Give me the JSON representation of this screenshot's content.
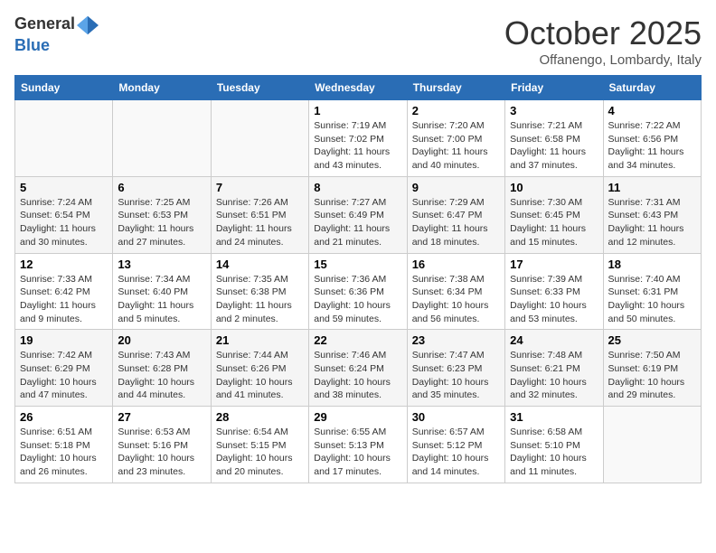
{
  "logo": {
    "general": "General",
    "blue": "Blue"
  },
  "header": {
    "month": "October 2025",
    "location": "Offanengo, Lombardy, Italy"
  },
  "weekdays": [
    "Sunday",
    "Monday",
    "Tuesday",
    "Wednesday",
    "Thursday",
    "Friday",
    "Saturday"
  ],
  "weeks": [
    [
      {
        "day": "",
        "sunrise": "",
        "sunset": "",
        "daylight": ""
      },
      {
        "day": "",
        "sunrise": "",
        "sunset": "",
        "daylight": ""
      },
      {
        "day": "",
        "sunrise": "",
        "sunset": "",
        "daylight": ""
      },
      {
        "day": "1",
        "sunrise": "Sunrise: 7:19 AM",
        "sunset": "Sunset: 7:02 PM",
        "daylight": "Daylight: 11 hours and 43 minutes."
      },
      {
        "day": "2",
        "sunrise": "Sunrise: 7:20 AM",
        "sunset": "Sunset: 7:00 PM",
        "daylight": "Daylight: 11 hours and 40 minutes."
      },
      {
        "day": "3",
        "sunrise": "Sunrise: 7:21 AM",
        "sunset": "Sunset: 6:58 PM",
        "daylight": "Daylight: 11 hours and 37 minutes."
      },
      {
        "day": "4",
        "sunrise": "Sunrise: 7:22 AM",
        "sunset": "Sunset: 6:56 PM",
        "daylight": "Daylight: 11 hours and 34 minutes."
      }
    ],
    [
      {
        "day": "5",
        "sunrise": "Sunrise: 7:24 AM",
        "sunset": "Sunset: 6:54 PM",
        "daylight": "Daylight: 11 hours and 30 minutes."
      },
      {
        "day": "6",
        "sunrise": "Sunrise: 7:25 AM",
        "sunset": "Sunset: 6:53 PM",
        "daylight": "Daylight: 11 hours and 27 minutes."
      },
      {
        "day": "7",
        "sunrise": "Sunrise: 7:26 AM",
        "sunset": "Sunset: 6:51 PM",
        "daylight": "Daylight: 11 hours and 24 minutes."
      },
      {
        "day": "8",
        "sunrise": "Sunrise: 7:27 AM",
        "sunset": "Sunset: 6:49 PM",
        "daylight": "Daylight: 11 hours and 21 minutes."
      },
      {
        "day": "9",
        "sunrise": "Sunrise: 7:29 AM",
        "sunset": "Sunset: 6:47 PM",
        "daylight": "Daylight: 11 hours and 18 minutes."
      },
      {
        "day": "10",
        "sunrise": "Sunrise: 7:30 AM",
        "sunset": "Sunset: 6:45 PM",
        "daylight": "Daylight: 11 hours and 15 minutes."
      },
      {
        "day": "11",
        "sunrise": "Sunrise: 7:31 AM",
        "sunset": "Sunset: 6:43 PM",
        "daylight": "Daylight: 11 hours and 12 minutes."
      }
    ],
    [
      {
        "day": "12",
        "sunrise": "Sunrise: 7:33 AM",
        "sunset": "Sunset: 6:42 PM",
        "daylight": "Daylight: 11 hours and 9 minutes."
      },
      {
        "day": "13",
        "sunrise": "Sunrise: 7:34 AM",
        "sunset": "Sunset: 6:40 PM",
        "daylight": "Daylight: 11 hours and 5 minutes."
      },
      {
        "day": "14",
        "sunrise": "Sunrise: 7:35 AM",
        "sunset": "Sunset: 6:38 PM",
        "daylight": "Daylight: 11 hours and 2 minutes."
      },
      {
        "day": "15",
        "sunrise": "Sunrise: 7:36 AM",
        "sunset": "Sunset: 6:36 PM",
        "daylight": "Daylight: 10 hours and 59 minutes."
      },
      {
        "day": "16",
        "sunrise": "Sunrise: 7:38 AM",
        "sunset": "Sunset: 6:34 PM",
        "daylight": "Daylight: 10 hours and 56 minutes."
      },
      {
        "day": "17",
        "sunrise": "Sunrise: 7:39 AM",
        "sunset": "Sunset: 6:33 PM",
        "daylight": "Daylight: 10 hours and 53 minutes."
      },
      {
        "day": "18",
        "sunrise": "Sunrise: 7:40 AM",
        "sunset": "Sunset: 6:31 PM",
        "daylight": "Daylight: 10 hours and 50 minutes."
      }
    ],
    [
      {
        "day": "19",
        "sunrise": "Sunrise: 7:42 AM",
        "sunset": "Sunset: 6:29 PM",
        "daylight": "Daylight: 10 hours and 47 minutes."
      },
      {
        "day": "20",
        "sunrise": "Sunrise: 7:43 AM",
        "sunset": "Sunset: 6:28 PM",
        "daylight": "Daylight: 10 hours and 44 minutes."
      },
      {
        "day": "21",
        "sunrise": "Sunrise: 7:44 AM",
        "sunset": "Sunset: 6:26 PM",
        "daylight": "Daylight: 10 hours and 41 minutes."
      },
      {
        "day": "22",
        "sunrise": "Sunrise: 7:46 AM",
        "sunset": "Sunset: 6:24 PM",
        "daylight": "Daylight: 10 hours and 38 minutes."
      },
      {
        "day": "23",
        "sunrise": "Sunrise: 7:47 AM",
        "sunset": "Sunset: 6:23 PM",
        "daylight": "Daylight: 10 hours and 35 minutes."
      },
      {
        "day": "24",
        "sunrise": "Sunrise: 7:48 AM",
        "sunset": "Sunset: 6:21 PM",
        "daylight": "Daylight: 10 hours and 32 minutes."
      },
      {
        "day": "25",
        "sunrise": "Sunrise: 7:50 AM",
        "sunset": "Sunset: 6:19 PM",
        "daylight": "Daylight: 10 hours and 29 minutes."
      }
    ],
    [
      {
        "day": "26",
        "sunrise": "Sunrise: 6:51 AM",
        "sunset": "Sunset: 5:18 PM",
        "daylight": "Daylight: 10 hours and 26 minutes."
      },
      {
        "day": "27",
        "sunrise": "Sunrise: 6:53 AM",
        "sunset": "Sunset: 5:16 PM",
        "daylight": "Daylight: 10 hours and 23 minutes."
      },
      {
        "day": "28",
        "sunrise": "Sunrise: 6:54 AM",
        "sunset": "Sunset: 5:15 PM",
        "daylight": "Daylight: 10 hours and 20 minutes."
      },
      {
        "day": "29",
        "sunrise": "Sunrise: 6:55 AM",
        "sunset": "Sunset: 5:13 PM",
        "daylight": "Daylight: 10 hours and 17 minutes."
      },
      {
        "day": "30",
        "sunrise": "Sunrise: 6:57 AM",
        "sunset": "Sunset: 5:12 PM",
        "daylight": "Daylight: 10 hours and 14 minutes."
      },
      {
        "day": "31",
        "sunrise": "Sunrise: 6:58 AM",
        "sunset": "Sunset: 5:10 PM",
        "daylight": "Daylight: 10 hours and 11 minutes."
      },
      {
        "day": "",
        "sunrise": "",
        "sunset": "",
        "daylight": ""
      }
    ]
  ]
}
